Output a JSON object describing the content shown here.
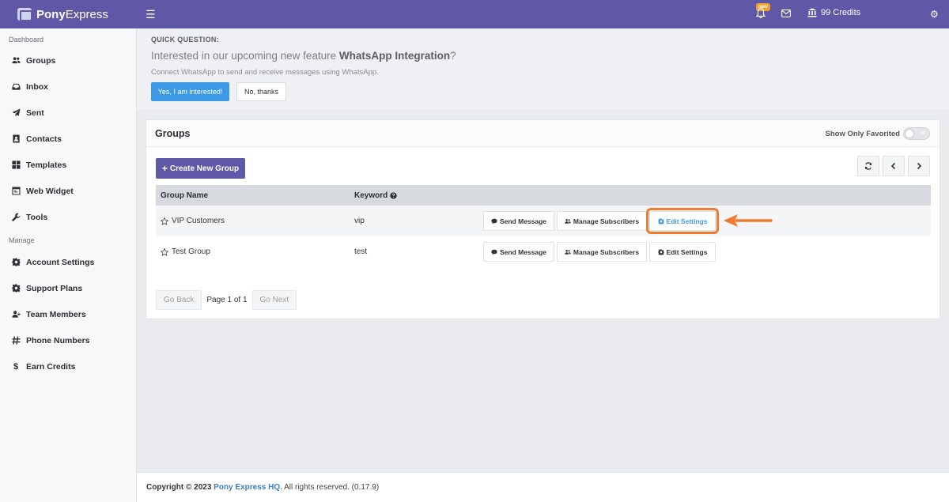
{
  "topbar": {
    "brand_bold": "Pony",
    "brand_rest": "Express",
    "new_badge": "new",
    "credits": "99 Credits",
    "accent": "#5f58a7"
  },
  "sidebar": {
    "section_dashboard": "Dashboard",
    "section_manage": "Manage",
    "items": [
      {
        "label": "Groups",
        "icon": "users-icon"
      },
      {
        "label": "Inbox",
        "icon": "inbox-icon"
      },
      {
        "label": "Sent",
        "icon": "paper-plane-icon"
      },
      {
        "label": "Contacts",
        "icon": "address-book-icon"
      },
      {
        "label": "Templates",
        "icon": "grid-icon"
      },
      {
        "label": "Web Widget",
        "icon": "window-icon"
      },
      {
        "label": "Tools",
        "icon": "wrench-icon"
      }
    ],
    "manage_items": [
      {
        "label": "Account Settings",
        "icon": "gear-icon"
      },
      {
        "label": "Support Plans",
        "icon": "gear-icon"
      },
      {
        "label": "Team Members",
        "icon": "user-plus-icon"
      },
      {
        "label": "Phone Numbers",
        "icon": "hash-icon"
      },
      {
        "label": "Earn Credits",
        "icon": "dollar-icon"
      }
    ]
  },
  "quick_question": {
    "label": "QUICK QUESTION:",
    "title_prefix": "Interested in our upcoming new feature ",
    "title_feature": "WhatsApp Integration",
    "title_suffix": "?",
    "subtitle": "Connect WhatsApp to send and receive messages using WhatsApp.",
    "yes_label": "Yes, I am interested!",
    "no_label": "No, thanks"
  },
  "groups": {
    "title": "Groups",
    "fav_label": "Show Only Favorited",
    "toggle_text": "off",
    "create_label": "Create New Group",
    "columns": {
      "name": "Group Name",
      "keyword": "Keyword"
    },
    "rows": [
      {
        "name": "VIP Customers",
        "keyword": "vip"
      },
      {
        "name": "Test Group",
        "keyword": "test"
      }
    ],
    "actions": {
      "send": "Send Message",
      "manage": "Manage Subscribers",
      "edit": "Edit Settings"
    },
    "pager": {
      "back": "Go Back",
      "page": "Page 1 of 1",
      "next": "Go Next"
    }
  },
  "footer": {
    "prefix": "Copyright © 2023 ",
    "company": "Pony Express HQ",
    "suffix": ". All rights reserved. (0.17.9)"
  },
  "colors": {
    "primary": "#5f58a7",
    "blue": "#3c99e8",
    "highlight": "#f07a2e"
  }
}
